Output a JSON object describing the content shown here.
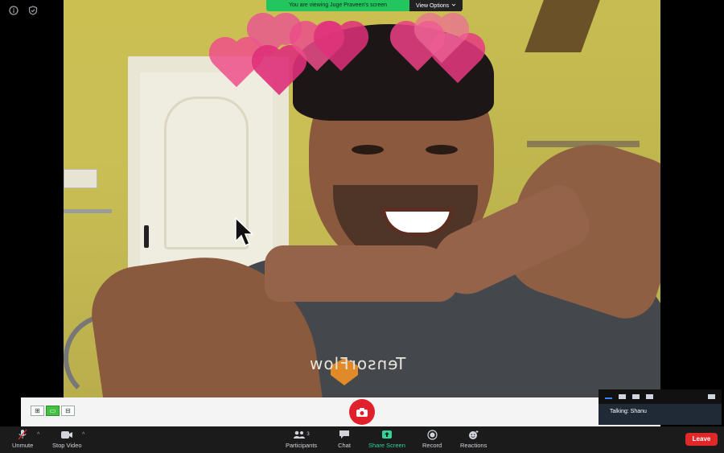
{
  "banner": {
    "viewing_text": "You are viewing Juge Praveen's screen",
    "view_options_label": "View Options"
  },
  "video": {
    "shirt_logo_text": "TensorFlow"
  },
  "talking": {
    "label": "Talking: Shanu"
  },
  "toolbar": {
    "unmute_label": "Unmute",
    "stop_video_label": "Stop Video",
    "participants_label": "Participants",
    "participants_count": "3",
    "chat_label": "Chat",
    "share_screen_label": "Share Screen",
    "record_label": "Record",
    "reactions_label": "Reactions",
    "leave_label": "Leave"
  },
  "colors": {
    "banner_green": "#22c55e",
    "leave_red": "#e02828",
    "snapshot_red": "#e0202a",
    "share_green": "#34d399",
    "heart_pink": "#f0508a"
  }
}
